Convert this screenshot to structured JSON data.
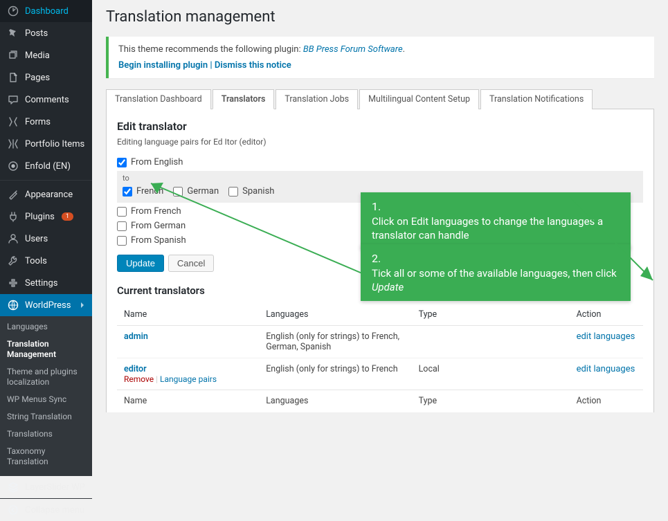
{
  "sidebar": {
    "items": [
      {
        "label": "Dashboard",
        "icon": "dashboard",
        "name": "sidebar-item-dashboard"
      },
      {
        "label": "Posts",
        "icon": "pin",
        "name": "sidebar-item-posts"
      },
      {
        "label": "Media",
        "icon": "media",
        "name": "sidebar-item-media"
      },
      {
        "label": "Pages",
        "icon": "page",
        "name": "sidebar-item-pages"
      },
      {
        "label": "Comments",
        "icon": "comment",
        "name": "sidebar-item-comments"
      },
      {
        "label": "Forms",
        "icon": "forms",
        "name": "sidebar-item-forms"
      },
      {
        "label": "Portfolio Items",
        "icon": "portfolio",
        "name": "sidebar-item-portfolio"
      },
      {
        "label": "Enfold (EN)",
        "icon": "enfold",
        "name": "sidebar-item-enfold"
      }
    ],
    "items2": [
      {
        "label": "Appearance",
        "icon": "appearance",
        "name": "sidebar-item-appearance"
      },
      {
        "label": "Plugins",
        "icon": "plugin",
        "badge": "1",
        "name": "sidebar-item-plugins"
      },
      {
        "label": "Users",
        "icon": "users",
        "name": "sidebar-item-users"
      },
      {
        "label": "Tools",
        "icon": "tools",
        "name": "sidebar-item-tools"
      },
      {
        "label": "Settings",
        "icon": "settings",
        "name": "sidebar-item-settings"
      }
    ],
    "current": {
      "label": "WorldPress",
      "icon": "world",
      "name": "sidebar-item-worldpress"
    },
    "submenu": [
      {
        "label": "Languages"
      },
      {
        "label": "Translation Management",
        "current": true
      },
      {
        "label": "Theme and plugins localization"
      },
      {
        "label": "WP Menus Sync"
      },
      {
        "label": "String Translation"
      },
      {
        "label": "Translations"
      },
      {
        "label": "Taxonomy Translation"
      }
    ],
    "items3": [
      {
        "label": "LayerSlider WP",
        "icon": "layers",
        "name": "sidebar-item-layerslider"
      }
    ],
    "collapse_label": "Collapse menu"
  },
  "page": {
    "title": "Translation management"
  },
  "notice": {
    "text": "This theme recommends the following plugin: ",
    "link": "BB Press Forum Software",
    "action1": "Begin installing plugin",
    "action2": "Dismiss this notice"
  },
  "tabs": [
    {
      "label": "Translation Dashboard",
      "name": "tab-translation-dashboard"
    },
    {
      "label": "Translators",
      "name": "tab-translators",
      "active": true
    },
    {
      "label": "Translation Jobs",
      "name": "tab-translation-jobs"
    },
    {
      "label": "Multilingual Content Setup",
      "name": "tab-multilingual-content-setup"
    },
    {
      "label": "Translation Notifications",
      "name": "tab-translation-notifications"
    }
  ],
  "edit": {
    "heading": "Edit translator",
    "subheading": "Editing language pairs for Ed Itor (editor)",
    "from_english": "From English",
    "to_label": "to",
    "to_langs": [
      {
        "label": "French",
        "checked": true
      },
      {
        "label": "German",
        "checked": false
      },
      {
        "label": "Spanish",
        "checked": false
      }
    ],
    "from_rows": [
      {
        "label": "From French"
      },
      {
        "label": "From German"
      },
      {
        "label": "From Spanish"
      }
    ],
    "update": "Update",
    "cancel": "Cancel"
  },
  "current": {
    "heading": "Current translators",
    "cols": {
      "name": "Name",
      "languages": "Languages",
      "type": "Type",
      "action": "Action"
    },
    "rows": [
      {
        "name": "admin",
        "languages": "English (only for strings) to French, German, Spanish",
        "type": "",
        "action": "edit languages"
      },
      {
        "name": "editor",
        "row_remove": "Remove",
        "row_pairs": "Language pairs",
        "languages": "English (only for strings) to French",
        "type": "Local",
        "action": "edit languages"
      }
    ]
  },
  "callouts": {
    "c1_num": "1.",
    "c1_text": "Click on Edit languages to change the languages a translator can handle",
    "c2_num": "2.",
    "c2_text_a": "Tick all or some of the available languages, then click ",
    "c2_text_b": "Update"
  }
}
